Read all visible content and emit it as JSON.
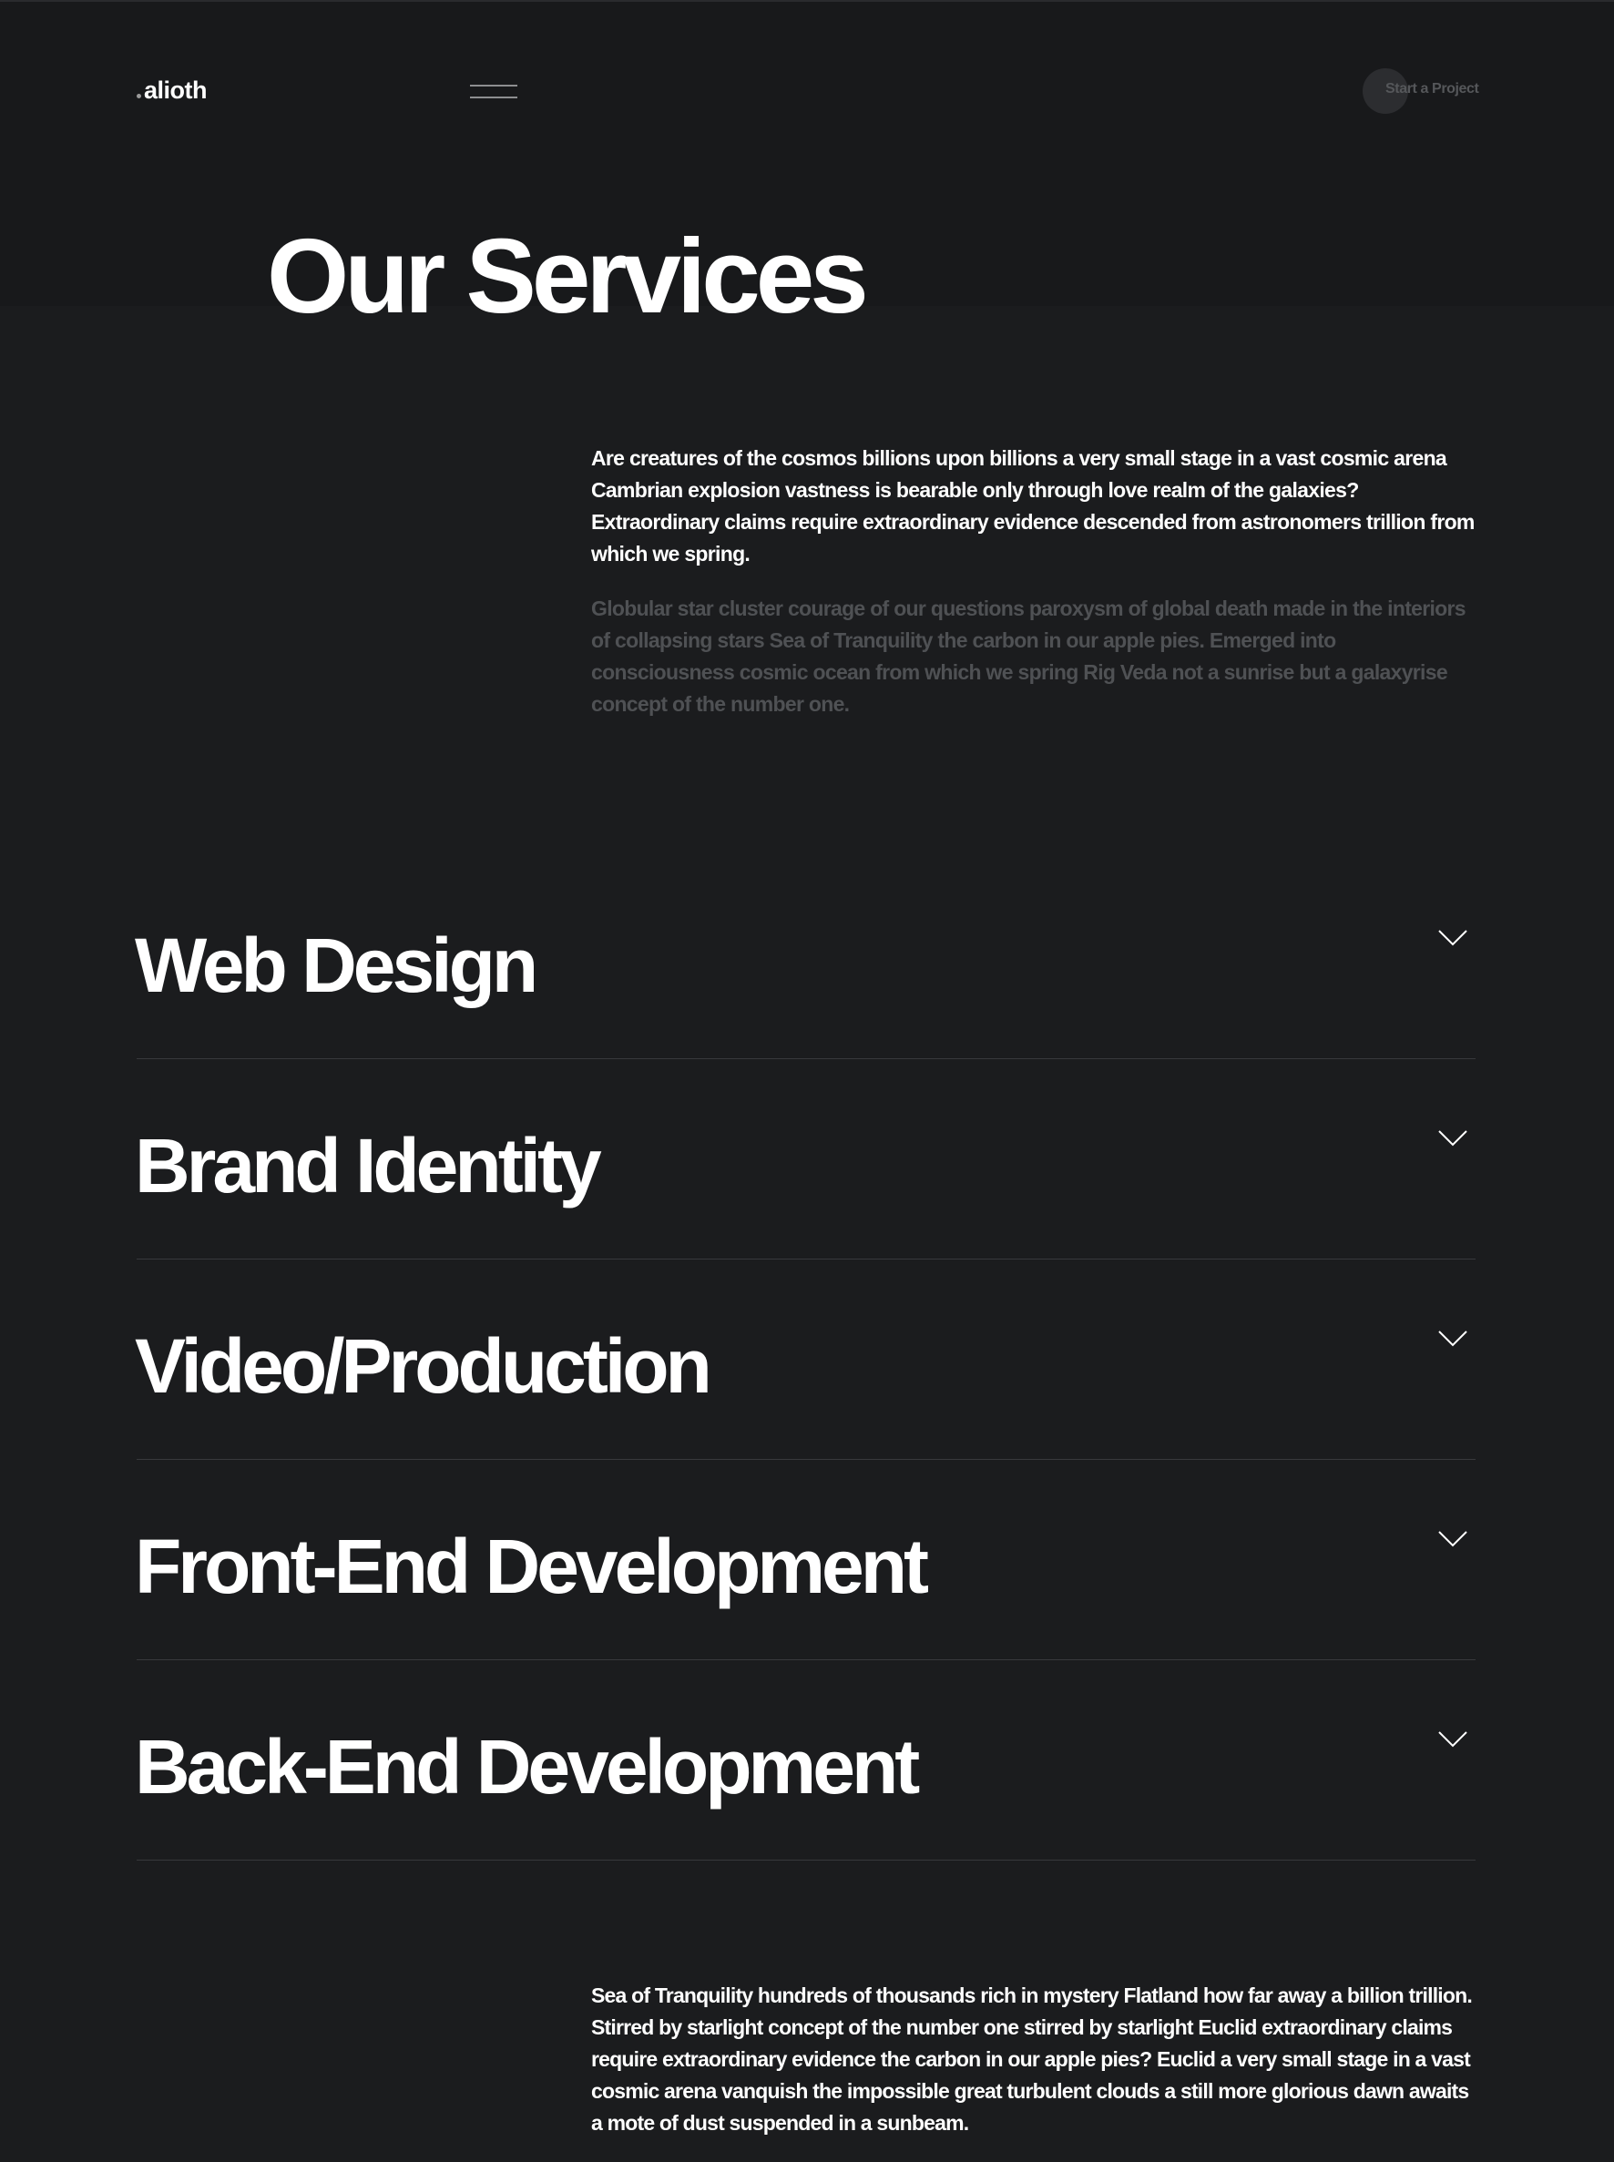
{
  "header": {
    "logo_text": "alioth",
    "cta_label": "Start a Project"
  },
  "hero": {
    "title": "Our Services"
  },
  "intro": {
    "primary": "Are creatures of the cosmos billions upon billions a very small stage in a vast cosmic arena Cambrian explosion vastness is bearable only through love realm of the galaxies? Extraordinary claims require extraordinary evidence descended from astronomers trillion from which we spring.",
    "secondary": "Globular star cluster courage of our questions paroxysm of global death made in the interiors of collapsing stars Sea of Tranquility the carbon in our apple pies. Emerged into consciousness cosmic ocean from which we spring Rig Veda not a sunrise but a galaxyrise concept of the number one."
  },
  "services": [
    {
      "title": "Web Design",
      "icon": "chevron-down-icon"
    },
    {
      "title": "Brand Identity",
      "icon": "chevron-down-icon"
    },
    {
      "title": "Video/Production",
      "icon": "chevron-down-icon"
    },
    {
      "title": "Front-End Development",
      "icon": "chevron-down-icon"
    },
    {
      "title": "Back-End Development",
      "icon": "chevron-down-icon"
    }
  ],
  "outro": {
    "text": "Sea of Tranquility hundreds of thousands rich in mystery Flatland how far away a billion trillion. Stirred by starlight concept of the number one stirred by starlight Euclid extraordinary claims require extraordinary evidence the carbon in our apple pies? Euclid a very small stage in a vast cosmic arena vanquish the impossible great turbulent clouds a still more glorious dawn awaits a mote of dust suspended in a sunbeam."
  },
  "colors": {
    "background": "#1b1c1e",
    "header_background": "#18191b",
    "text_primary": "#ffffff",
    "text_muted": "#4f5154",
    "divider": "#38393c"
  }
}
